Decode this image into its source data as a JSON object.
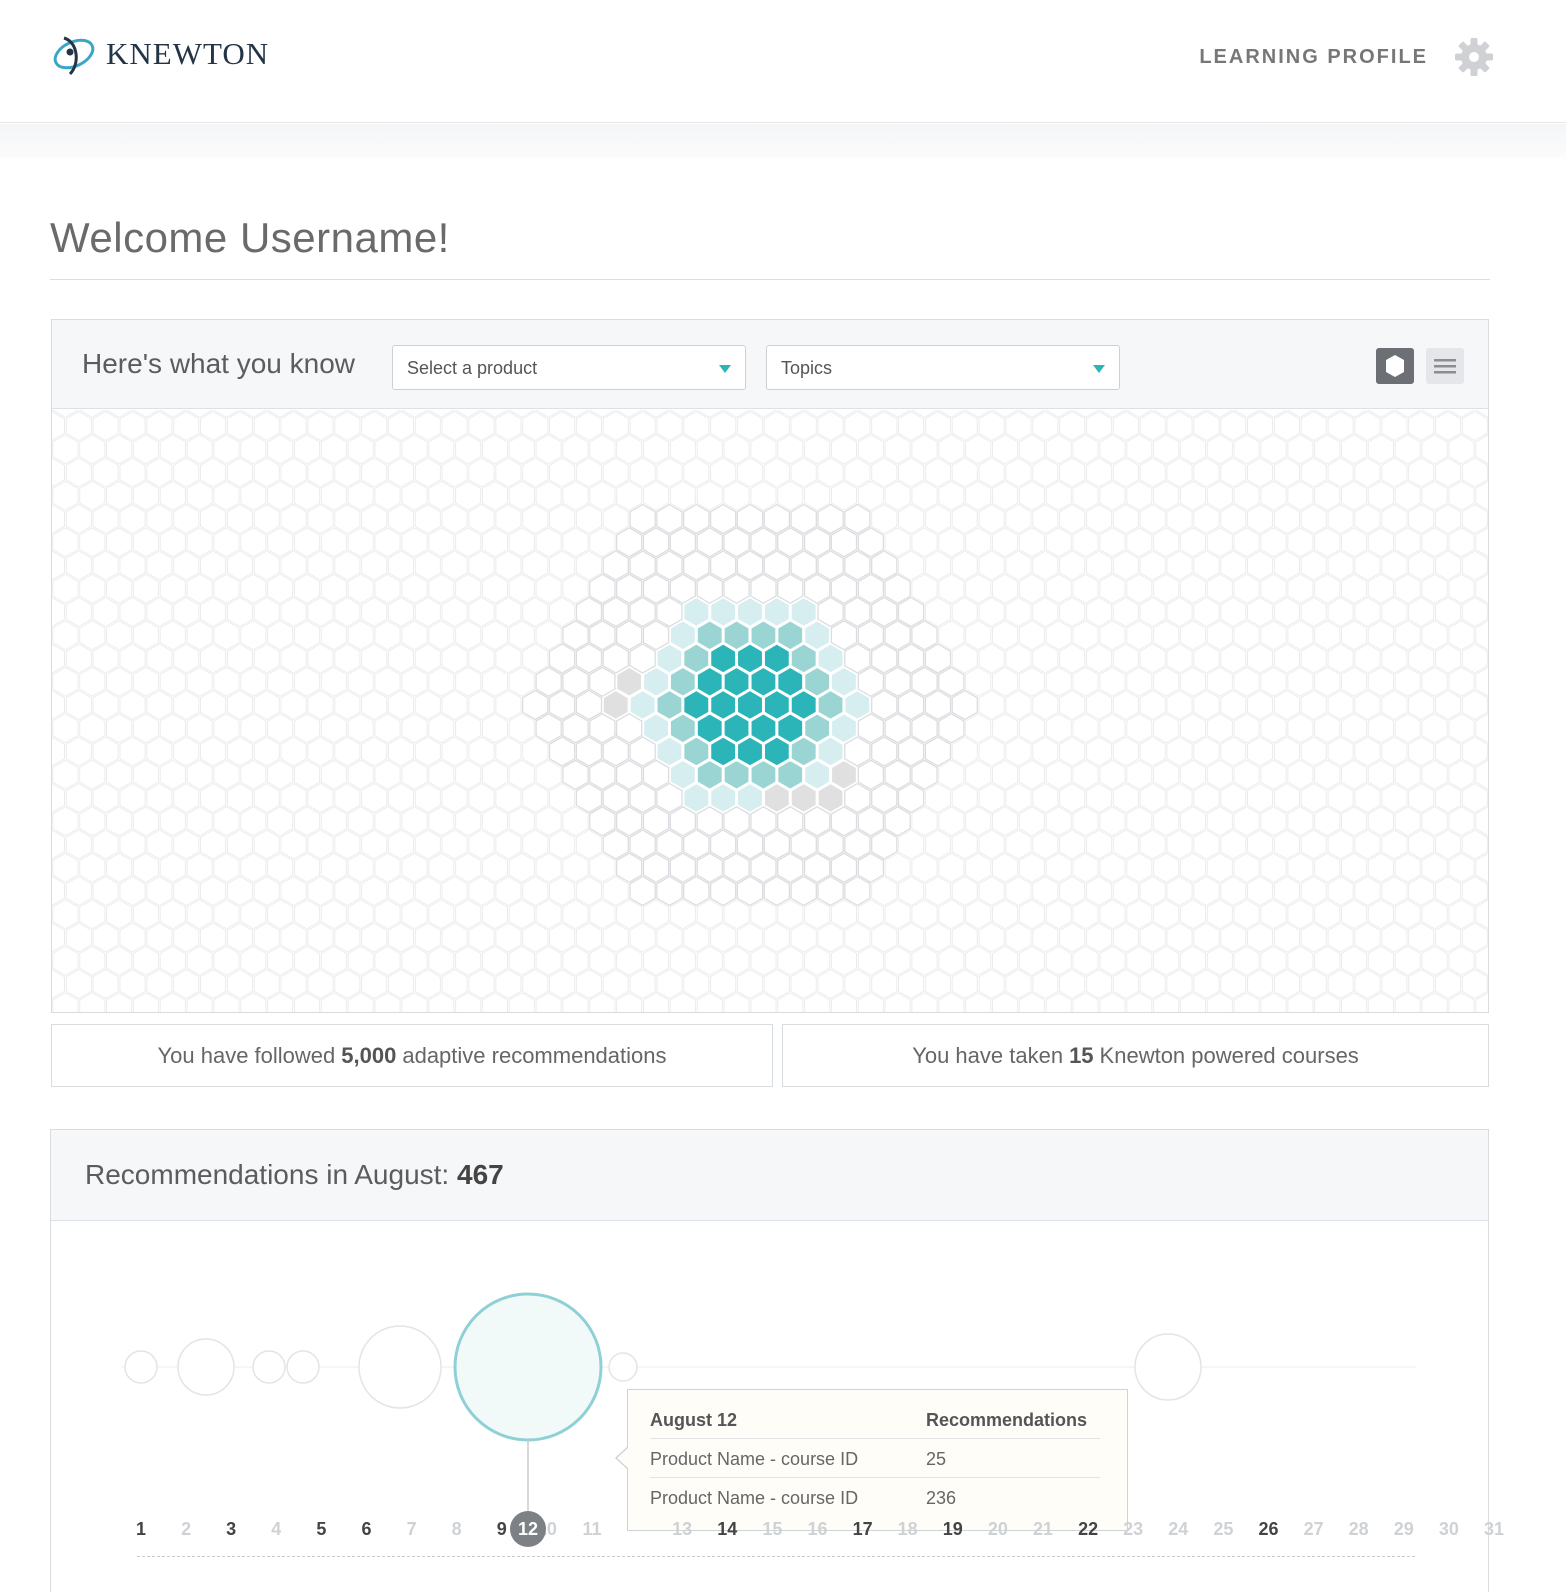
{
  "brand": {
    "name": "KNEWTON"
  },
  "nav": {
    "learning_profile": "LEARNING PROFILE",
    "settings_icon": "gear-icon"
  },
  "welcome": {
    "title": "Welcome Username!"
  },
  "knowledge": {
    "title": "Here's what you know",
    "product_select": {
      "selected": "Select a product"
    },
    "topics_select": {
      "selected": "Topics"
    },
    "view_toggle": {
      "hex_icon": "hexagon-icon",
      "list_icon": "list-icon"
    },
    "colors": {
      "mastered": "#2bb5b8",
      "proficient": "#9bd5d3",
      "learning": "#d7eef0",
      "struggling": "#e0e0e0",
      "empty": "#ffffff"
    }
  },
  "stats": {
    "followed": {
      "prefix": "You have followed",
      "value": "5,000",
      "suffix": "adaptive recommendations"
    },
    "courses": {
      "prefix": "You have taken",
      "value": "15",
      "suffix": "Knewton powered courses"
    }
  },
  "recommendations": {
    "title_prefix": "Recommendations in August:",
    "total": "467",
    "selected_day": 12,
    "days": [
      {
        "label": "1",
        "active": true
      },
      {
        "label": "2",
        "active": false
      },
      {
        "label": "3",
        "active": true
      },
      {
        "label": "4",
        "active": false
      },
      {
        "label": "5",
        "active": true
      },
      {
        "label": "6",
        "active": true
      },
      {
        "label": "7",
        "active": false
      },
      {
        "label": "8",
        "active": false
      },
      {
        "label": "9",
        "active": true
      },
      {
        "label": "10",
        "active": false
      },
      {
        "label": "11",
        "active": false
      },
      {
        "label": "12",
        "active": true
      },
      {
        "label": "13",
        "active": false
      },
      {
        "label": "14",
        "active": true
      },
      {
        "label": "15",
        "active": false
      },
      {
        "label": "16",
        "active": false
      },
      {
        "label": "17",
        "active": true
      },
      {
        "label": "18",
        "active": false
      },
      {
        "label": "19",
        "active": true
      },
      {
        "label": "20",
        "active": false
      },
      {
        "label": "21",
        "active": false
      },
      {
        "label": "22",
        "active": true
      },
      {
        "label": "23",
        "active": false
      },
      {
        "label": "24",
        "active": false
      },
      {
        "label": "25",
        "active": false
      },
      {
        "label": "26",
        "active": true
      },
      {
        "label": "27",
        "active": false
      },
      {
        "label": "28",
        "active": false
      },
      {
        "label": "29",
        "active": false
      },
      {
        "label": "30",
        "active": false
      },
      {
        "label": "31",
        "active": false
      }
    ],
    "tooltip": {
      "date": "August 12",
      "column": "Recommendations",
      "rows": [
        {
          "name": "Product Name - course ID",
          "value": "25"
        },
        {
          "name": "Product Name - course ID",
          "value": "236"
        }
      ]
    }
  }
}
